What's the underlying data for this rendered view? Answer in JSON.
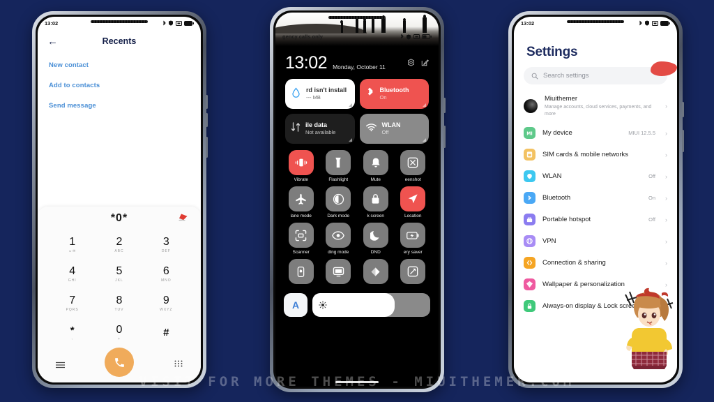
{
  "background_color": "#15255c",
  "watermark": "VISIT FOR MORE THEMES - MIUITHEMER.COM",
  "accent_red": "#ef5350",
  "accent_orange": "#f0ab5b",
  "phone1": {
    "status": {
      "time": "13:02"
    },
    "header": {
      "back": "←",
      "title": "Recents"
    },
    "actions": [
      {
        "label": "New contact"
      },
      {
        "label": "Add to contacts"
      },
      {
        "label": "Send message"
      }
    ],
    "dialpad": {
      "number": "*0*",
      "keys": [
        {
          "digit": "1",
          "sub": "☺✉"
        },
        {
          "digit": "2",
          "sub": "ABC"
        },
        {
          "digit": "3",
          "sub": "DEF"
        },
        {
          "digit": "4",
          "sub": "GHI"
        },
        {
          "digit": "5",
          "sub": "JKL"
        },
        {
          "digit": "6",
          "sub": "MNO"
        },
        {
          "digit": "7",
          "sub": "PQRS"
        },
        {
          "digit": "8",
          "sub": "TUV"
        },
        {
          "digit": "9",
          "sub": "WXYZ"
        },
        {
          "digit": "*",
          "sub": ","
        },
        {
          "digit": "0",
          "sub": "+"
        },
        {
          "digit": "#",
          "sub": ""
        }
      ]
    }
  },
  "phone2": {
    "status": {
      "carrier": "gency calls only"
    },
    "clock": {
      "time": "13:02",
      "date": "Monday, October 11"
    },
    "big_tiles": [
      {
        "title": "rd isn't install",
        "subtitle": "--- MB",
        "style": "white",
        "icon": "water-drop-icon"
      },
      {
        "title": "Bluetooth",
        "subtitle": "On",
        "style": "red",
        "icon": "bluetooth-icon"
      },
      {
        "title": "ile data",
        "subtitle": "Not available",
        "style": "dark",
        "icon": "mobile-data-icon"
      },
      {
        "title": "WLAN",
        "subtitle": "Off",
        "style": "gray",
        "icon": "wifi-icon"
      }
    ],
    "toggles": [
      {
        "label": "Vibrate",
        "icon": "vibrate-icon",
        "on": true
      },
      {
        "label": "Flashlight",
        "icon": "flashlight-icon",
        "on": false
      },
      {
        "label": "Mute",
        "icon": "bell-icon",
        "on": false
      },
      {
        "label": "eenshot",
        "icon": "screenshot-icon",
        "on": false
      },
      {
        "label": "lane mode",
        "icon": "airplane-icon",
        "on": false
      },
      {
        "label": "Dark mode",
        "icon": "contrast-icon",
        "on": false
      },
      {
        "label": "k screen",
        "icon": "lock-icon",
        "on": false
      },
      {
        "label": "Location",
        "icon": "location-arrow-icon",
        "on": true
      },
      {
        "label": "Scanner",
        "icon": "scan-frame-icon",
        "on": false
      },
      {
        "label": "ding mode",
        "icon": "eye-icon",
        "on": false
      },
      {
        "label": "DND",
        "icon": "moon-icon",
        "on": false
      },
      {
        "label": "ery saver",
        "icon": "battery-icon",
        "on": false
      },
      {
        "label": "",
        "icon": "power-icon",
        "on": false
      },
      {
        "label": "",
        "icon": "cast-screen-icon",
        "on": false
      },
      {
        "label": "",
        "icon": "sync-icon",
        "on": false
      },
      {
        "label": "",
        "icon": "rotate-icon",
        "on": false
      }
    ],
    "brightness": {
      "auto_label": "A",
      "value_percent": 70,
      "icon": "sun-icon"
    }
  },
  "phone3": {
    "status": {
      "time": "13:02"
    },
    "title": "Settings",
    "search": {
      "placeholder": "Search settings",
      "icon": "search-icon"
    },
    "items": [
      {
        "label": "Miuithemer",
        "sub": "Manage accounts, cloud services, payments, and more",
        "value": "",
        "icon": "account-avatar",
        "color": "#000000"
      },
      {
        "label": "My device",
        "sub": "",
        "value": "MIUI 12.5.5",
        "icon": "mi-logo-icon",
        "color": "#5ec98a"
      },
      {
        "label": "SIM cards & mobile networks",
        "sub": "",
        "value": "",
        "icon": "sim-card-icon",
        "color": "#f3c262"
      },
      {
        "label": "WLAN",
        "sub": "",
        "value": "Off",
        "icon": "wlan-icon",
        "color": "#3dc8f0"
      },
      {
        "label": "Bluetooth",
        "sub": "",
        "value": "On",
        "icon": "bluetooth-icon",
        "color": "#4aa8f5"
      },
      {
        "label": "Portable hotspot",
        "sub": "",
        "value": "Off",
        "icon": "hotspot-icon",
        "color": "#8b7cf0"
      },
      {
        "label": "VPN",
        "sub": "",
        "value": "",
        "icon": "vpn-icon",
        "color": "#a88cf5"
      },
      {
        "label": "Connection & sharing",
        "sub": "",
        "value": "",
        "icon": "connection-icon",
        "color": "#f5a524"
      },
      {
        "label": "Wallpaper & personalization",
        "sub": "",
        "value": "",
        "icon": "wallpaper-icon",
        "color": "#ef5aa0"
      },
      {
        "label": "Always-on display & Lock screen",
        "sub": "",
        "value": "",
        "icon": "lock-screen-icon",
        "color": "#3fc97a"
      }
    ]
  }
}
